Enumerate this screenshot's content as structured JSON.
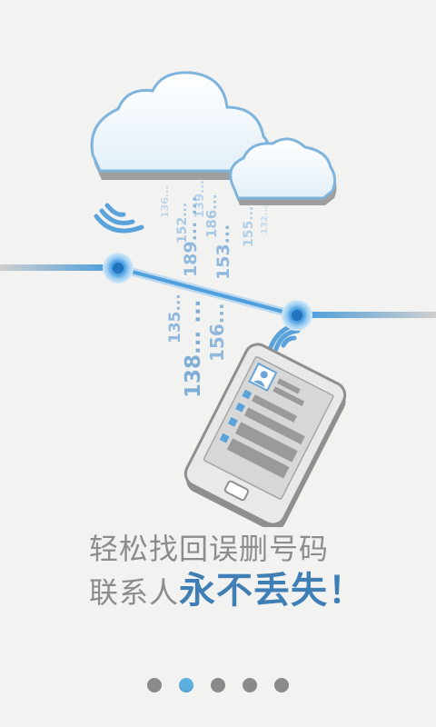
{
  "headline": {
    "line1": "轻松找回误删号码",
    "line2_prefix": "联系人",
    "line2_emphasis": "永不丢失！"
  },
  "numbers": {
    "n136": "136...",
    "n152": "152...",
    "n139": "139...",
    "n189": "189... ...",
    "n186": "186...",
    "n153": "153...",
    "n155": "155...",
    "n132": "132...",
    "n135": "135...",
    "n138": "138... ...",
    "n156": "156..."
  },
  "pager": {
    "count": 5,
    "active_index": 1
  },
  "colors": {
    "background": "#f2f2f1",
    "accent_blue": "#3f7fb5",
    "light_blue": "#5aaee0",
    "text_gray": "#8c8c8c",
    "dot_gray": "#8a8a8a"
  }
}
